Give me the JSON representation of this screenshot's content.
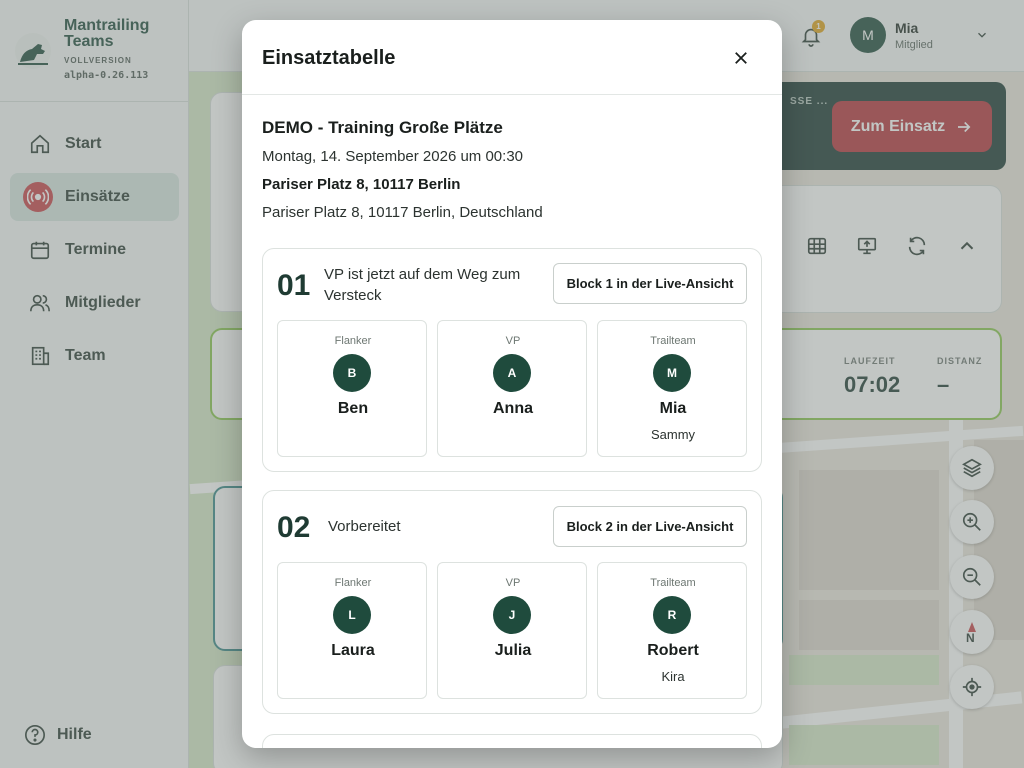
{
  "brand": {
    "name": "Mantrailing Teams",
    "edition": "VOLLVERSION",
    "version": "alpha-0.26.113"
  },
  "nav": {
    "items": [
      {
        "label": "Start",
        "icon": "home-icon",
        "active": false
      },
      {
        "label": "Einsätze",
        "icon": "radio-signal-icon",
        "active": true
      },
      {
        "label": "Termine",
        "icon": "calendar-icon",
        "active": false
      },
      {
        "label": "Mitglieder",
        "icon": "users-icon",
        "active": false
      },
      {
        "label": "Team",
        "icon": "building-icon",
        "active": false
      }
    ],
    "help_label": "Hilfe"
  },
  "topbar": {
    "notification_count": "1",
    "user_initial": "M",
    "user_name": "Mia",
    "user_role": "Mitglied"
  },
  "background": {
    "banner_text": "SSE ...",
    "go_button": "Zum Einsatz",
    "stats": {
      "runtime_label": "LAUFZEIT",
      "runtime_value": "07:02",
      "distance_label": "DISTANZ",
      "distance_value": "–"
    }
  },
  "modal": {
    "title": "Einsatztabelle",
    "event": {
      "title": "DEMO - Training Große Plätze",
      "date": "Montag, 14. September 2026 um 00:30",
      "address": "Pariser Platz 8, 10117 Berlin",
      "full_address": "Pariser Platz 8, 10117 Berlin, Deutschland"
    },
    "blocks": [
      {
        "number": "01",
        "status": "VP ist jetzt auf dem Weg zum Versteck",
        "button": "Block 1 in der Live-Ansicht",
        "roles": [
          {
            "role": "Flanker",
            "initial": "B",
            "name": "Ben",
            "dog": ""
          },
          {
            "role": "VP",
            "initial": "A",
            "name": "Anna",
            "dog": ""
          },
          {
            "role": "Trailteam",
            "initial": "M",
            "name": "Mia",
            "dog": "Sammy"
          }
        ]
      },
      {
        "number": "02",
        "status": "Vorbereitet",
        "button": "Block 2 in der Live-Ansicht",
        "roles": [
          {
            "role": "Flanker",
            "initial": "L",
            "name": "Laura",
            "dog": ""
          },
          {
            "role": "VP",
            "initial": "J",
            "name": "Julia",
            "dog": ""
          },
          {
            "role": "Trailteam",
            "initial": "R",
            "name": "Robert",
            "dog": "Kira"
          }
        ]
      }
    ]
  },
  "colors": {
    "primary": "#1f4b3d",
    "accent_red": "#c94449",
    "active_nav_bg": "#d7e6e1"
  }
}
